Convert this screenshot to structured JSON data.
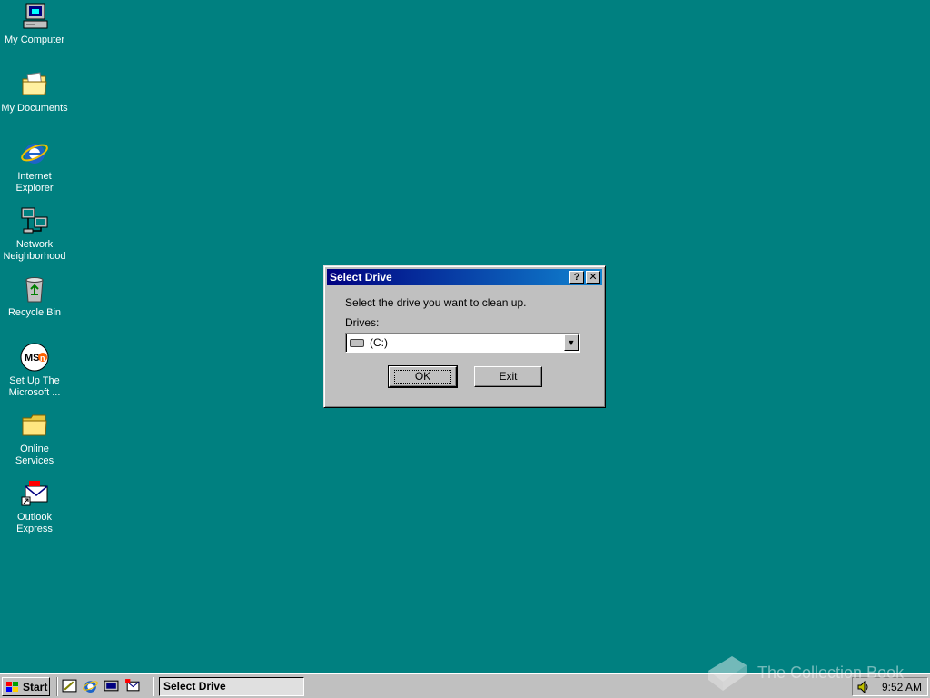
{
  "desktop": {
    "background": "#008080",
    "icons": [
      {
        "label": "My Computer",
        "icon": "my-computer-icon"
      },
      {
        "label": "My Documents",
        "icon": "folder-icon"
      },
      {
        "label": "Internet\nExplorer",
        "icon": "internet-explorer-icon"
      },
      {
        "label": "Network\nNeighborhood",
        "icon": "network-icon"
      },
      {
        "label": "Recycle Bin",
        "icon": "recycle-bin-icon"
      },
      {
        "label": "Set Up The\nMicrosoft ...",
        "icon": "msn-icon"
      },
      {
        "label": "Online\nServices",
        "icon": "folder-icon"
      },
      {
        "label": "Outlook\nExpress",
        "icon": "outlook-express-icon"
      }
    ]
  },
  "dialog": {
    "title": "Select Drive",
    "help_btn": "?",
    "close_btn": "✕",
    "prompt": "Select the drive you want to clean up.",
    "drives_label": "Drives:",
    "drive_value": "(C:)",
    "ok_label": "OK",
    "exit_label": "Exit"
  },
  "taskbar": {
    "start_label": "Start",
    "quick_launch": [
      "show-desktop-icon",
      "internet-explorer-icon",
      "channels-icon",
      "outlook-express-icon"
    ],
    "task_label": "Select Drive",
    "clock": "9:52 AM"
  },
  "watermark": "The Collection Book",
  "colors": {
    "titlebar_start": "#000080",
    "titlebar_end": "#1084d0",
    "face": "#c0c0c0"
  }
}
